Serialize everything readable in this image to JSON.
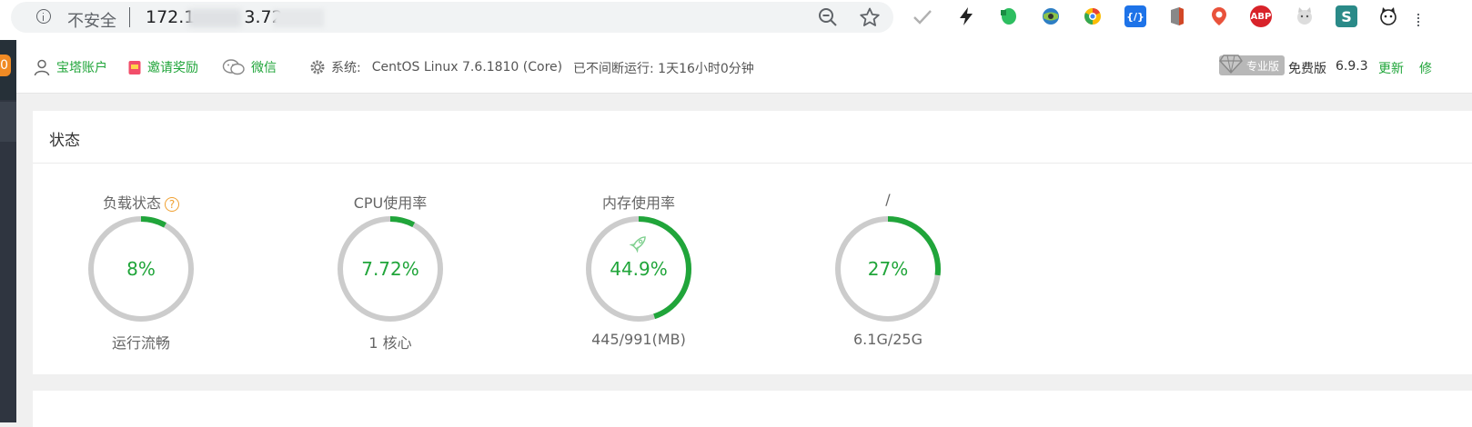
{
  "browser": {
    "security_label": "不安全",
    "url_start": "172.1",
    "url_mid": "3.72:",
    "extensions": [
      "check-icon",
      "lightning-icon",
      "evernote-icon",
      "globe-icon",
      "chrome-ext-icon",
      "code-icon",
      "office-icon",
      "map-pin-icon",
      "adblock-icon",
      "cat-icon",
      "s-icon",
      "cat-face-icon"
    ],
    "adblock_label": "ABP"
  },
  "sidebar": {
    "badge": "0"
  },
  "topbar": {
    "account_label": "宝塔账户",
    "invite_label": "邀请奖励",
    "wechat_label": "微信",
    "system_prefix": "系统:",
    "system_value": "CentOS Linux 7.6.1810 (Core)",
    "uptime": "已不间断运行: 1天16小时0分钟",
    "pro_label": "专业版",
    "free_label": "免费版",
    "version": "6.9.3",
    "update_label": "更新",
    "repair_label": "修"
  },
  "status_panel": {
    "title": "状态",
    "gauges": [
      {
        "name": "load",
        "label": "负载状态",
        "value_text": "8%",
        "percent": 8,
        "sub": "运行流畅",
        "help": "?"
      },
      {
        "name": "cpu",
        "label": "CPU使用率",
        "value_text": "7.72%",
        "percent": 7.72,
        "sub": "1 核心"
      },
      {
        "name": "memory",
        "label": "内存使用率",
        "value_text": "44.9%",
        "percent": 44.9,
        "sub": "445/991(MB)"
      },
      {
        "name": "disk",
        "label": "/",
        "value_text": "27%",
        "percent": 27,
        "sub": "6.1G/25G"
      }
    ]
  },
  "colors": {
    "accent": "#20a53a",
    "track": "#cccccc",
    "help": "#f0a030"
  }
}
